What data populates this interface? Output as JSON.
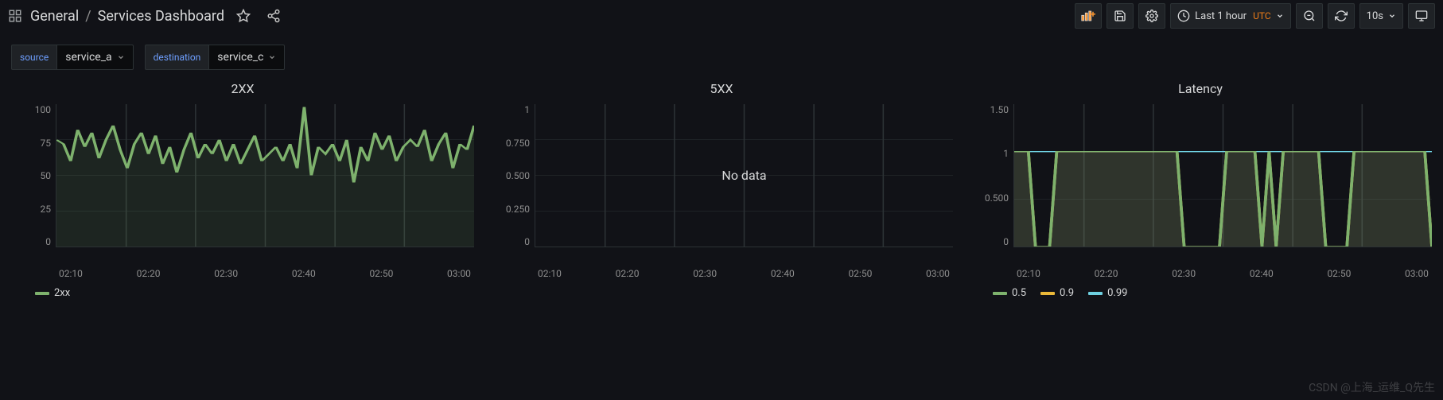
{
  "header": {
    "folder": "General",
    "separator": "/",
    "title": "Services Dashboard",
    "time_label": "Last 1 hour",
    "time_tz": "UTC",
    "refresh_interval": "10s"
  },
  "vars": {
    "source": {
      "label": "source",
      "value": "service_a"
    },
    "destination": {
      "label": "destination",
      "value": "service_c"
    }
  },
  "panels": {
    "p2xx": {
      "title": "2XX",
      "y_ticks": [
        "100",
        "75",
        "50",
        "25",
        "0"
      ],
      "x_ticks": [
        "02:10",
        "02:20",
        "02:30",
        "02:40",
        "02:50",
        "03:00"
      ],
      "legend": [
        {
          "name": "2xx",
          "color": "#7eb26d"
        }
      ]
    },
    "p5xx": {
      "title": "5XX",
      "y_ticks": [
        "1",
        "0.750",
        "0.500",
        "0.250",
        "0"
      ],
      "x_ticks": [
        "02:10",
        "02:20",
        "02:30",
        "02:40",
        "02:50",
        "03:00"
      ],
      "no_data": "No data"
    },
    "latency": {
      "title": "Latency",
      "y_ticks": [
        "1.50",
        "1",
        "0.500",
        "0"
      ],
      "x_ticks": [
        "02:10",
        "02:20",
        "02:30",
        "02:40",
        "02:50",
        "03:00"
      ],
      "legend": [
        {
          "name": "0.5",
          "color": "#7eb26d"
        },
        {
          "name": "0.9",
          "color": "#eab839"
        },
        {
          "name": "0.99",
          "color": "#6ed0e0"
        }
      ]
    }
  },
  "watermark": "CSDN @上海_运维_Q先生",
  "chart_data": [
    {
      "type": "line",
      "title": "2XX",
      "ylabel": "",
      "ylim": [
        0,
        100
      ],
      "x": [
        "02:05",
        "02:06",
        "02:07",
        "02:08",
        "02:09",
        "02:10",
        "02:11",
        "02:12",
        "02:13",
        "02:14",
        "02:15",
        "02:16",
        "02:17",
        "02:18",
        "02:19",
        "02:20",
        "02:21",
        "02:22",
        "02:23",
        "02:24",
        "02:25",
        "02:26",
        "02:27",
        "02:28",
        "02:29",
        "02:30",
        "02:31",
        "02:32",
        "02:33",
        "02:34",
        "02:35",
        "02:36",
        "02:37",
        "02:38",
        "02:39",
        "02:40",
        "02:41",
        "02:42",
        "02:43",
        "02:44",
        "02:45",
        "02:46",
        "02:47",
        "02:48",
        "02:49",
        "02:50",
        "02:51",
        "02:52",
        "02:53",
        "02:54",
        "02:55",
        "02:56",
        "02:57",
        "02:58",
        "02:59",
        "03:00",
        "03:01",
        "03:02",
        "03:03",
        "03:04"
      ],
      "series": [
        {
          "name": "2xx",
          "values": [
            75,
            72,
            60,
            82,
            70,
            80,
            62,
            75,
            85,
            68,
            55,
            72,
            80,
            65,
            78,
            58,
            70,
            52,
            68,
            80,
            62,
            72,
            65,
            75,
            60,
            72,
            58,
            68,
            78,
            60,
            65,
            70,
            60,
            72,
            55,
            98,
            50,
            70,
            65,
            72,
            60,
            75,
            45,
            70,
            60,
            80,
            68,
            78,
            60,
            70,
            75,
            70,
            82,
            60,
            72,
            80,
            55,
            72,
            68,
            85
          ]
        }
      ]
    },
    {
      "type": "line",
      "title": "5XX",
      "ylim": [
        0,
        1
      ],
      "x": [
        "02:10",
        "02:20",
        "02:30",
        "02:40",
        "02:50",
        "03:00"
      ],
      "series": [],
      "annotation": "No data"
    },
    {
      "type": "line",
      "title": "Latency",
      "ylim": [
        0,
        1.5
      ],
      "x": [
        "02:05",
        "02:06",
        "02:07",
        "02:08",
        "02:09",
        "02:10",
        "02:11",
        "02:12",
        "02:13",
        "02:14",
        "02:15",
        "02:16",
        "02:17",
        "02:18",
        "02:19",
        "02:20",
        "02:21",
        "02:22",
        "02:23",
        "02:24",
        "02:25",
        "02:26",
        "02:27",
        "02:28",
        "02:29",
        "02:30",
        "02:31",
        "02:32",
        "02:33",
        "02:34",
        "02:35",
        "02:36",
        "02:37",
        "02:38",
        "02:39",
        "02:40",
        "02:41",
        "02:42",
        "02:43",
        "02:44",
        "02:45",
        "02:46",
        "02:47",
        "02:48",
        "02:49",
        "02:50",
        "02:51",
        "02:52",
        "02:53",
        "02:54",
        "02:55",
        "02:56",
        "02:57",
        "02:58",
        "02:59",
        "03:00",
        "03:01",
        "03:02",
        "03:03",
        "03:04"
      ],
      "series": [
        {
          "name": "0.5",
          "values": [
            1,
            1,
            1,
            0,
            0,
            0,
            1,
            1,
            1,
            1,
            1,
            1,
            1,
            1,
            1,
            1,
            1,
            1,
            1,
            1,
            1,
            1,
            1,
            1,
            0,
            0,
            0,
            0,
            0,
            0,
            1,
            1,
            1,
            1,
            1,
            0,
            1,
            0,
            1,
            1,
            1,
            1,
            1,
            1,
            0,
            0,
            0,
            0,
            1,
            1,
            1,
            1,
            1,
            1,
            1,
            1,
            1,
            1,
            1,
            0
          ]
        },
        {
          "name": "0.9",
          "values": [
            1,
            1,
            1,
            0,
            0,
            0,
            1,
            1,
            1,
            1,
            1,
            1,
            1,
            1,
            1,
            1,
            1,
            1,
            1,
            1,
            1,
            1,
            1,
            1,
            0,
            0,
            0,
            0,
            0,
            0,
            1,
            1,
            1,
            1,
            1,
            0,
            1,
            0,
            1,
            1,
            1,
            1,
            1,
            1,
            0,
            0,
            0,
            0,
            1,
            1,
            1,
            1,
            1,
            1,
            1,
            1,
            1,
            1,
            1,
            0
          ]
        },
        {
          "name": "0.99",
          "values": [
            1,
            1,
            1,
            1,
            1,
            1,
            1,
            1,
            1,
            1,
            1,
            1,
            1,
            1,
            1,
            1,
            1,
            1,
            1,
            1,
            1,
            1,
            1,
            1,
            1,
            1,
            1,
            1,
            1,
            1,
            1,
            1,
            1,
            1,
            1,
            1,
            1,
            1,
            1,
            1,
            1,
            1,
            1,
            1,
            1,
            1,
            1,
            1,
            1,
            1,
            1,
            1,
            1,
            1,
            1,
            1,
            1,
            1,
            1,
            1
          ]
        }
      ]
    }
  ]
}
